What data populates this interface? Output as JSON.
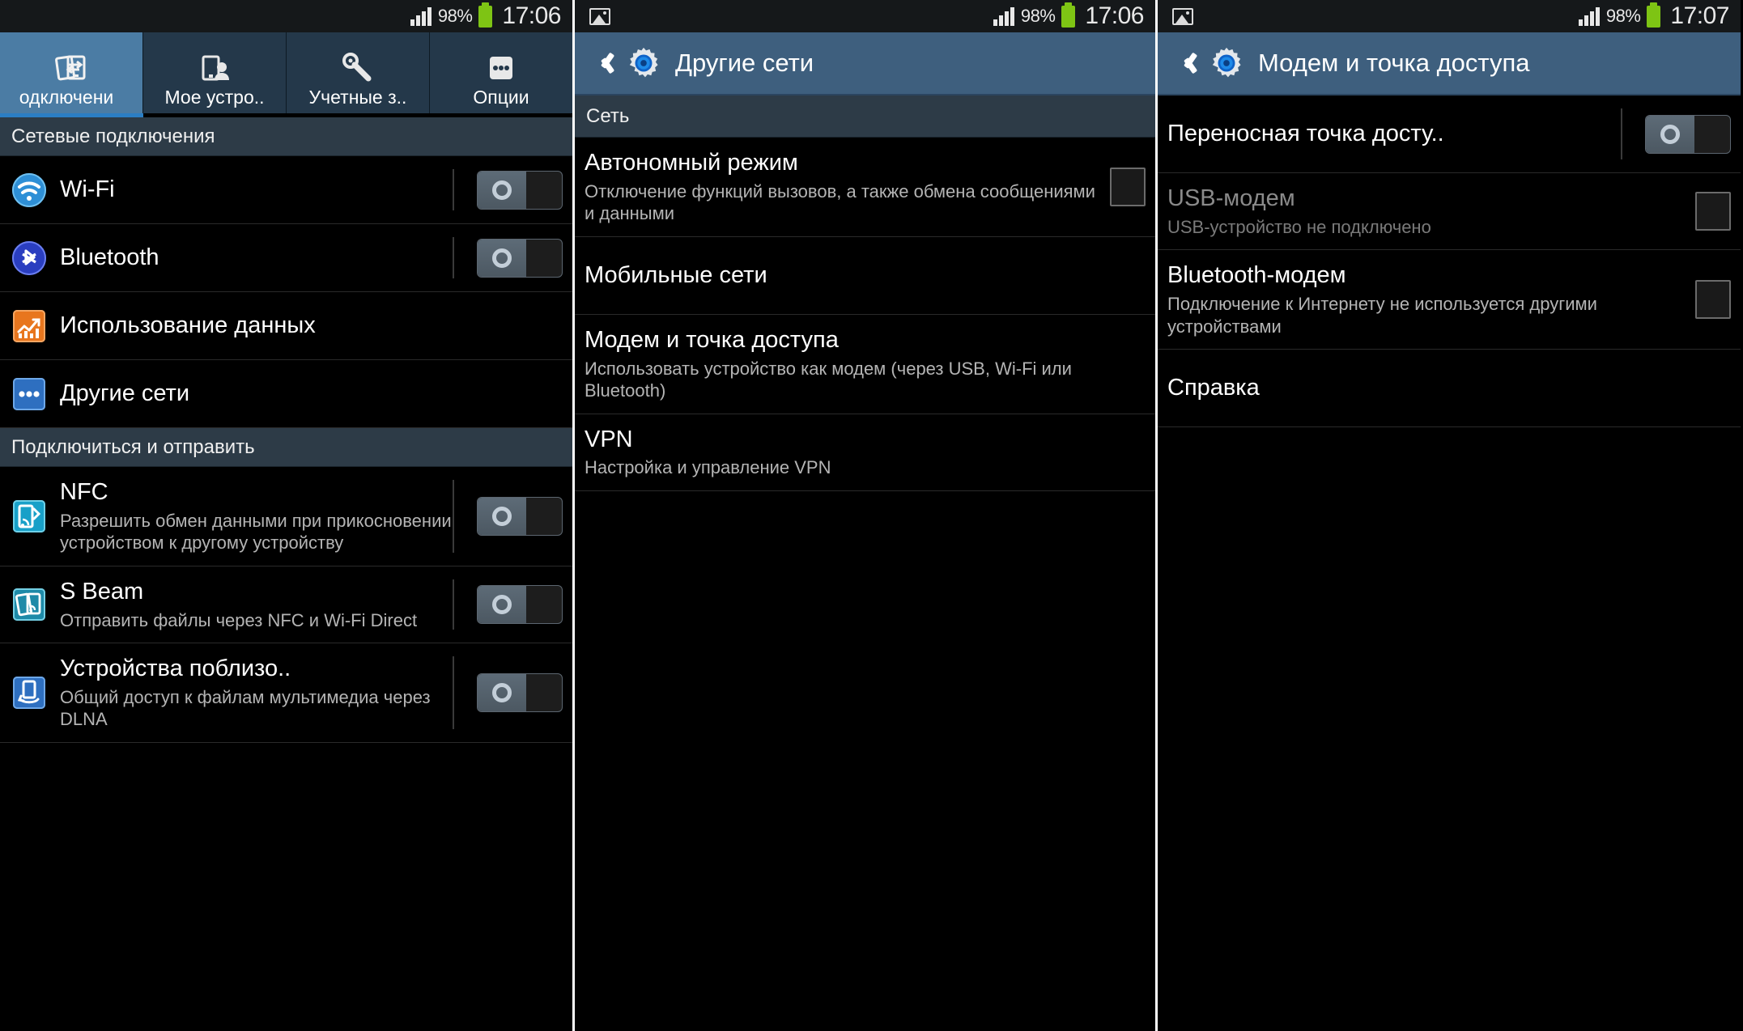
{
  "panel1": {
    "statusbar": {
      "signal_icon": "signal-bars-icon",
      "battery_percent": "98%",
      "battery_icon": "battery-icon",
      "time": "17:06"
    },
    "tabs": [
      {
        "label": "одключени",
        "icon": "connections-icon",
        "active": true
      },
      {
        "label": "Мое устро..",
        "icon": "my-device-icon",
        "active": false
      },
      {
        "label": "Учетные з..",
        "icon": "accounts-key-icon",
        "active": false
      },
      {
        "label": "Опции",
        "icon": "more-options-icon",
        "active": false
      }
    ],
    "sections": [
      {
        "header": "Сетевые подключения",
        "rows": [
          {
            "title": "Wi-Fi",
            "sub": "",
            "icon": "wifi-icon",
            "control": "toggle",
            "toggle_state": "off"
          },
          {
            "title": "Bluetooth",
            "sub": "",
            "icon": "bluetooth-icon",
            "control": "toggle",
            "toggle_state": "off"
          },
          {
            "title": "Использование данных",
            "sub": "",
            "icon": "data-usage-icon",
            "control": "none"
          },
          {
            "title": "Другие сети",
            "sub": "",
            "icon": "other-networks-icon",
            "control": "none"
          }
        ]
      },
      {
        "header": "Подключиться и отправить",
        "rows": [
          {
            "title": "NFC",
            "sub": "Разрешить обмен данными при прикосновении устройством к другому устройству",
            "icon": "nfc-icon",
            "control": "toggle",
            "toggle_state": "off"
          },
          {
            "title": "S Beam",
            "sub": "Отправить файлы через NFC и Wi-Fi Direct",
            "icon": "sbeam-icon",
            "control": "toggle",
            "toggle_state": "off"
          },
          {
            "title": "Устройства поблизо..",
            "sub": "Общий доступ к файлам мультимедиа через DLNA",
            "icon": "nearby-devices-icon",
            "control": "toggle",
            "toggle_state": "off"
          }
        ]
      }
    ]
  },
  "panel2": {
    "statusbar": {
      "image_icon": "picture-icon",
      "signal_icon": "signal-bars-icon",
      "battery_percent": "98%",
      "battery_icon": "battery-icon",
      "time": "17:06"
    },
    "actionbar": {
      "back_icon": "back-chevron-icon",
      "app_icon": "settings-gear-icon",
      "title": "Другие сети"
    },
    "sections": [
      {
        "header": "Сеть",
        "rows": [
          {
            "title": "Автономный режим",
            "sub": "Отключение функций вызовов, а также обмена сообщениями и данными",
            "control": "checkbox",
            "checked": false
          },
          {
            "title": "Мобильные сети",
            "sub": "",
            "control": "none"
          },
          {
            "title": "Модем и точка доступа",
            "sub": "Использовать устройство как модем (через USB, Wi-Fi или Bluetooth)",
            "control": "none"
          },
          {
            "title": "VPN",
            "sub": "Настройка и управление VPN",
            "control": "none"
          }
        ]
      }
    ]
  },
  "panel3": {
    "statusbar": {
      "image_icon": "picture-icon",
      "signal_icon": "signal-bars-icon",
      "battery_percent": "98%",
      "battery_icon": "battery-icon",
      "time": "17:07"
    },
    "actionbar": {
      "back_icon": "back-chevron-icon",
      "app_icon": "settings-gear-icon",
      "title": "Модем и точка доступа"
    },
    "rows": [
      {
        "title": "Переносная точка досту..",
        "sub": "",
        "control": "toggle",
        "toggle_state": "off",
        "disabled": false
      },
      {
        "title": "USB-модем",
        "sub": "USB-устройство не подключено",
        "control": "checkbox",
        "checked": false,
        "disabled": true
      },
      {
        "title": "Bluetooth-модем",
        "sub": "Подключение к Интернету не используется другими устройствами",
        "control": "checkbox",
        "checked": false,
        "disabled": false
      },
      {
        "title": "Справка",
        "sub": "",
        "control": "none",
        "disabled": false
      }
    ]
  },
  "colors": {
    "active_tab": "#4b7ca4",
    "inactive_tab": "#24384a",
    "actionbar": "#3e5f7e",
    "section_header": "#2d3b47",
    "accent_underline": "#2b7ec4",
    "battery_green": "#7ec414",
    "background": "#000000"
  }
}
